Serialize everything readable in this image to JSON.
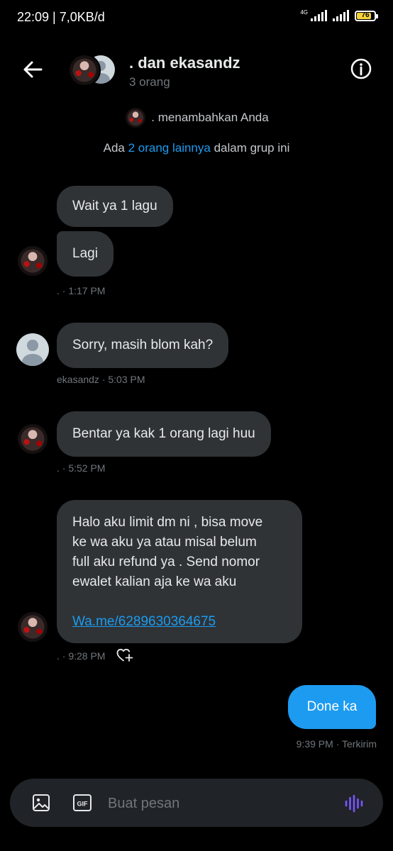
{
  "status_bar": {
    "time_speed": "22:09 | 7,0KB/d",
    "network_type": "4G",
    "battery": "76"
  },
  "header": {
    "title": ". dan ekasandz",
    "subtitle": "3 orang",
    "back_icon": "arrow-left-icon",
    "info_icon": "info-icon"
  },
  "system": {
    "added_text": ". menambahkan Anda",
    "others_prefix": "Ada ",
    "others_link": "2 orang lainnya",
    "others_suffix": " dalam grup ini"
  },
  "messages": [
    {
      "text": "Wait ya 1 lagu"
    },
    {
      "text": "Lagi",
      "meta": ". · 1:17 PM"
    },
    {
      "text": "Sorry, masih blom kah?",
      "meta": "ekasandz · 5:03 PM"
    },
    {
      "text": "Bentar ya kak 1 orang lagi huu",
      "meta": ". · 5:52 PM"
    },
    {
      "lines": [
        "Halo aku limit dm ni , bisa move",
        "ke wa aku ya atau misal belum",
        "full aku refund ya . Send nomor",
        "ewalet kalian aja ke wa aku"
      ],
      "link": "Wa.me/6289630364675",
      "meta": ". · 9:28 PM"
    },
    {
      "text": "Done ka",
      "meta": "9:39 PM · Terkirim",
      "outgoing": true
    }
  ],
  "composer": {
    "placeholder": "Buat pesan",
    "image_icon": "image-icon",
    "gif_label": "GIF",
    "voice_icon": "voice-wave-icon"
  },
  "colors": {
    "background": "#000000",
    "bubble_incoming": "#2f3336",
    "bubble_outgoing": "#1d9bf0",
    "link": "#1d9bf0",
    "voice_accent": "#7856ff"
  }
}
